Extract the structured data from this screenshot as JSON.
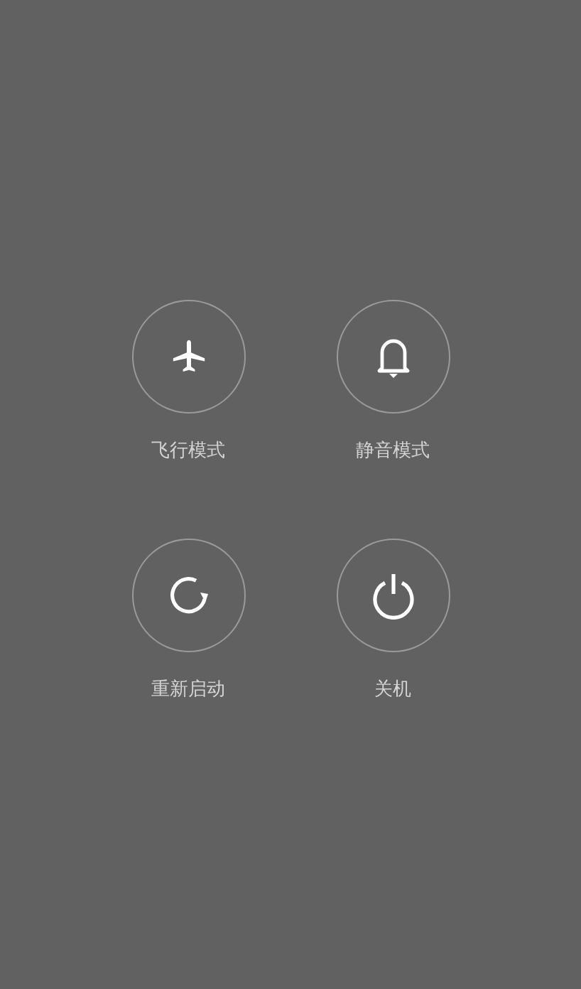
{
  "power_menu": {
    "items": [
      {
        "kind": "airplane",
        "label": "飞行模式"
      },
      {
        "kind": "bell",
        "label": "静音模式"
      },
      {
        "kind": "restart",
        "label": "重新启动"
      },
      {
        "kind": "power",
        "label": "关机"
      }
    ]
  }
}
